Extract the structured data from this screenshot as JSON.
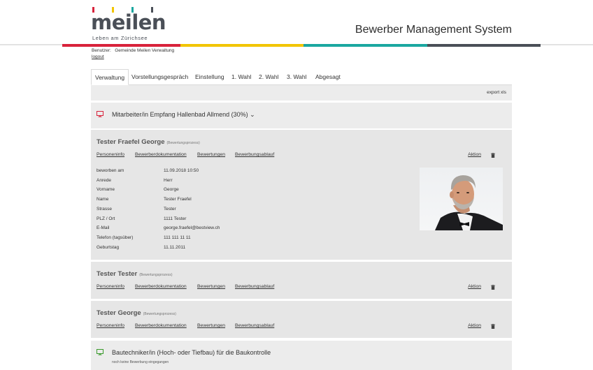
{
  "brand": {
    "logo_word": "meilen",
    "logo_tagline": "Leben am Zürichsee",
    "logo_bar_colors": [
      "#d8223b",
      "#f2c500",
      "#1aa7a0",
      "#4a4f57"
    ],
    "stripe_colors": [
      "#d8223b",
      "#f2c500",
      "#1aa7a0",
      "#4a4f57"
    ]
  },
  "header": {
    "app_title": "Bewerber Management System"
  },
  "user": {
    "label": "Benutzer:",
    "name": "Gemeinde Meilen Verwaltung",
    "logout": "logout"
  },
  "tabs": [
    {
      "label": "Verwaltung",
      "active": true
    },
    {
      "label": "Vorstellungsgespräch",
      "active": false
    },
    {
      "label": "Einstellung",
      "active": false
    },
    {
      "label": "1. Wahl",
      "active": false
    },
    {
      "label": "2. Wahl",
      "active": false
    },
    {
      "label": "3. Wahl",
      "active": false
    },
    {
      "label": "Abgesagt",
      "active": false
    }
  ],
  "toolbar": {
    "export": "export xls"
  },
  "jobs": [
    {
      "title": "Mitarbeiter/in Empfang Hallenbad Allmend (30%)",
      "chevron": "⌄",
      "icon": "monitor-icon",
      "icon_color": "#d8223b"
    },
    {
      "title": "Bautechniker/in (Hoch- oder Tiefbau) für die Baukontrolle",
      "subtitle": "noch keine Bewerbung eingegangen",
      "icon": "monitor-icon",
      "icon_color": "#3a9a2c"
    }
  ],
  "applicant_links": {
    "personeninfo": "Personeninfo",
    "dokumentation": "Bewerberdokumentation",
    "bewertungen": "Bewertungen",
    "ablauf": "Bewerbungsablauf",
    "aktion": "Aktion"
  },
  "applicants": [
    {
      "name": "Tester Fraefel  George",
      "status": "(Bewertungsprozess)",
      "expanded": true,
      "details": [
        {
          "label": "beworben am",
          "value": "11.09.2018 10:50"
        },
        {
          "label": "Anrede",
          "value": "Herr"
        },
        {
          "label": "Vorname",
          "value": "George"
        },
        {
          "label": "Name",
          "value": "Tester Fraefel"
        },
        {
          "label": "Strasse",
          "value": "Tester"
        },
        {
          "label": "PLZ / Ort",
          "value": "1111 Tester"
        },
        {
          "label": "E-Mail",
          "value": "george.fraefel@bestview.ch"
        },
        {
          "label": "Telefon (tagsüber)",
          "value": "111 111 11 11"
        },
        {
          "label": "Geburtstag",
          "value": "11.11.2011"
        }
      ]
    },
    {
      "name": "Tester  Tester",
      "status": "(Bewertungsprozess)",
      "expanded": false
    },
    {
      "name": "Tester  George",
      "status": "(Bewertungsprozess)",
      "expanded": false
    }
  ]
}
